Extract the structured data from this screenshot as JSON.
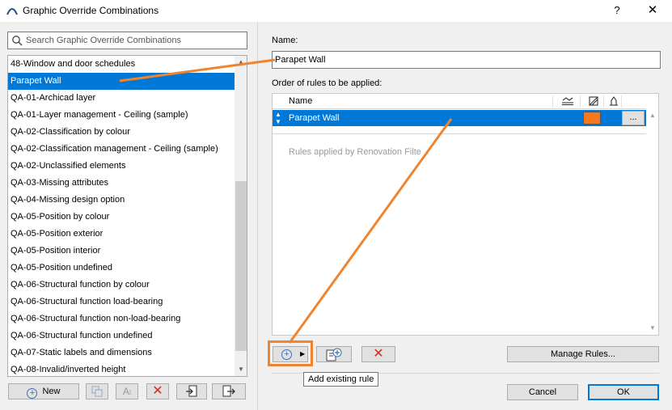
{
  "window": {
    "title": "Graphic Override Combinations",
    "help_label": "?",
    "close_label": "✕"
  },
  "search": {
    "placeholder": "Search Graphic Override Combinations"
  },
  "combinations": [
    "48-Window and door schedules",
    "Parapet Wall",
    "QA-01-Archicad layer",
    "QA-01-Layer management - Ceiling (sample)",
    "QA-02-Classification by colour",
    "QA-02-Classification management - Ceiling (sample)",
    "QA-02-Unclassified elements",
    "QA-03-Missing attributes",
    "QA-04-Missing design option",
    "QA-05-Position by colour",
    "QA-05-Position exterior",
    "QA-05-Position interior",
    "QA-05-Position undefined",
    "QA-06-Structural function by colour",
    "QA-06-Structural function load-bearing",
    "QA-06-Structural function non-load-bearing",
    "QA-06-Structural function undefined",
    "QA-07-Static labels and dimensions",
    "QA-08-Invalid/inverted height"
  ],
  "selected_index": 1,
  "left_toolbar": {
    "new_label": "New"
  },
  "detail": {
    "name_label": "Name:",
    "name_value": "Parapet Wall",
    "order_label": "Order of rules to be applied:",
    "column_name": "Name",
    "rules": [
      {
        "name": "Parapet Wall",
        "color": "#f5791f",
        "more_label": "..."
      }
    ],
    "renovation_text": "Rules applied by Renovation Filte"
  },
  "right_toolbar": {
    "manage_rules_label": "Manage Rules...",
    "tooltip": "Add existing rule"
  },
  "dialog_buttons": {
    "cancel_label": "Cancel",
    "ok_label": "OK"
  },
  "colors": {
    "selection": "#0078d7",
    "annotation": "#f0842e",
    "delete": "#d9281b"
  }
}
